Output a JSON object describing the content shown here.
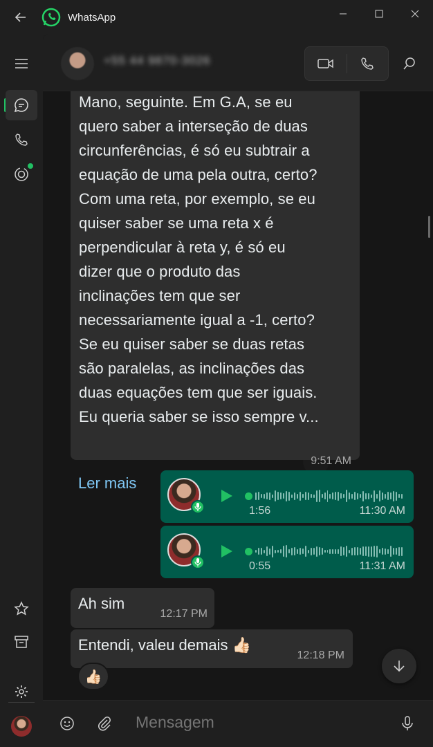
{
  "window": {
    "title": "WhatsApp"
  },
  "sidebar": {
    "items": [
      "menu",
      "chats",
      "calls",
      "status",
      "starred",
      "archived",
      "settings",
      "profile"
    ]
  },
  "header": {
    "contact_name": "+55 44 9870-3026"
  },
  "messages": {
    "long": {
      "text": "Mano, seguinte. Em G.A, se eu\nquero saber a interseção de duas\ncircunferências, é só eu subtrair a\nequação de uma pela outra, certo?\nCom uma reta, por exemplo, se eu\nquiser saber se uma reta x é\nperpendicular à reta y, é só eu\ndizer que o produto das\ninclinações tem que ser\nnecessariamente igual a -1, certo?\nSe eu quiser saber se duas retas\nsão paralelas, as inclinações das\nduas equações tem que ser iguais.\nEu queria saber se isso sempre v...",
      "read_more": "Ler mais",
      "time": "9:51 AM"
    },
    "voice1": {
      "duration": "1:56",
      "time": "11:30 AM"
    },
    "voice2": {
      "duration": "0:55",
      "time": "11:31 AM"
    },
    "msg3": {
      "text": "Ah sim",
      "time": "12:17 PM"
    },
    "msg4": {
      "text": "Entendi, valeu demais 👍🏻",
      "time": "12:18 PM"
    },
    "reaction": "👍🏻"
  },
  "composer": {
    "placeholder": "Mensagem"
  },
  "colors": {
    "accent": "#21c063",
    "outgoing": "#005c4b",
    "incoming": "#2e2e2e",
    "link": "#7fc7f5"
  }
}
